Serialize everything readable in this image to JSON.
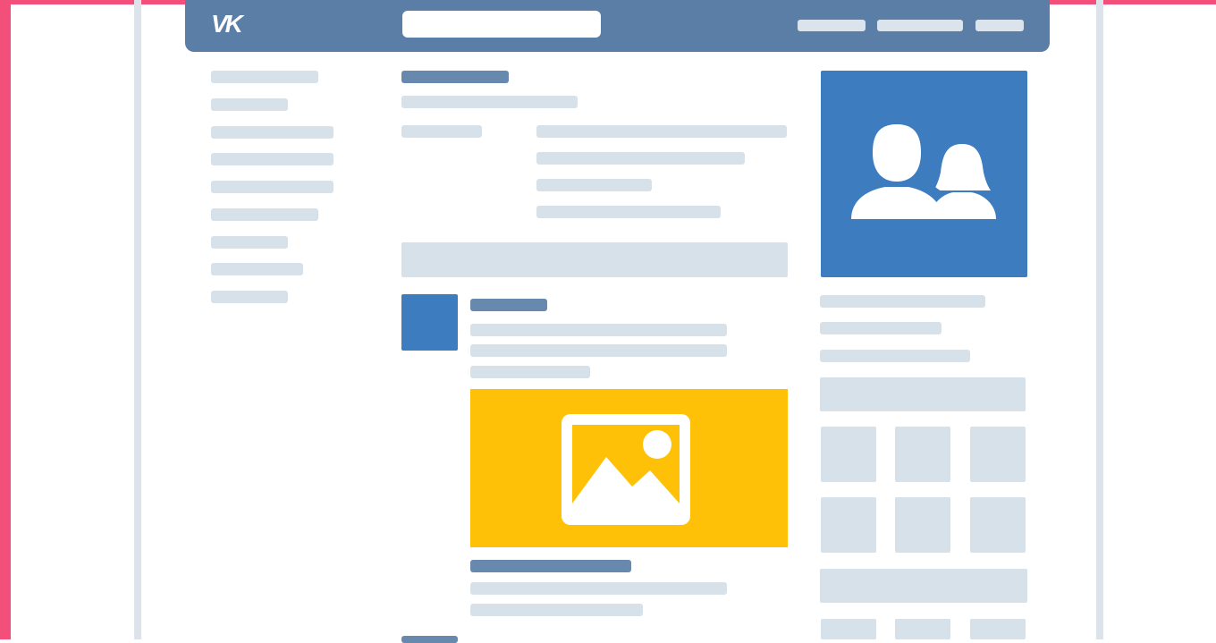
{
  "app": {
    "logo_text": "VK",
    "colors": {
      "accent_pink": "#f2507b",
      "header_blue": "#5a7ea6",
      "avatar_blue": "#3c7cbf",
      "placeholder_gray": "#d7e1e9",
      "image_yellow": "#fec107"
    }
  },
  "header": {
    "search": {
      "value": "",
      "placeholder": ""
    },
    "nav_items": [
      "",
      "",
      ""
    ]
  },
  "icons": {
    "profile_photo": "people-group-icon",
    "post_avatar": "avatar-icon",
    "post_image": "image-placeholder-icon"
  },
  "sidebar": {
    "menu_item_count": 9
  },
  "friends_grid": {
    "tile_count": 9
  }
}
